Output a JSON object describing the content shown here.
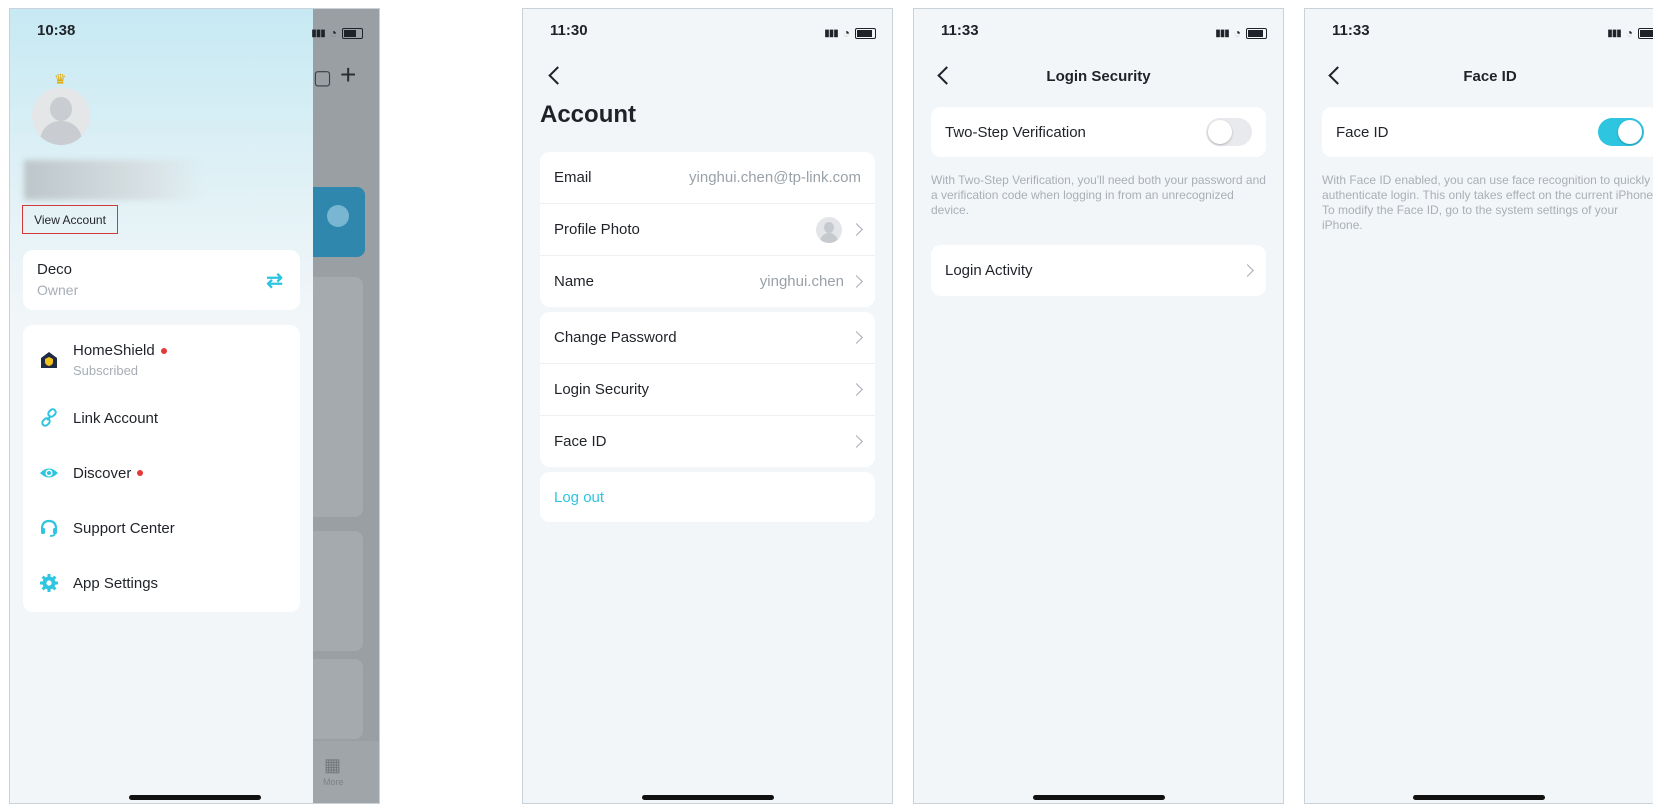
{
  "colors": {
    "accent": "#2ec5e0",
    "red_dot": "#e53935",
    "annotation_box": "#d23a3a"
  },
  "screen1": {
    "time": "10:38",
    "view_account": "View Account",
    "deco_card": {
      "title": "Deco",
      "subtitle": "Owner"
    },
    "menu": [
      {
        "label": "HomeShield",
        "sub": "Subscribed",
        "icon": "homeshield-icon",
        "dot": true
      },
      {
        "label": "Link Account",
        "icon": "link-icon",
        "dot": false
      },
      {
        "label": "Discover",
        "icon": "eye-icon",
        "dot": true
      },
      {
        "label": "Support Center",
        "icon": "headset-icon",
        "dot": false
      },
      {
        "label": "App Settings",
        "icon": "gear-icon",
        "dot": false
      }
    ],
    "bg_tab_label": "More"
  },
  "screen2": {
    "time": "11:30",
    "title": "Account",
    "group1": [
      {
        "label": "Email",
        "value": "yinghui.chen@tp-link.com"
      },
      {
        "label": "Profile Photo"
      },
      {
        "label": "Name",
        "value": "yinghui.chen"
      }
    ],
    "group2": [
      {
        "label": "Change Password"
      },
      {
        "label": "Login Security"
      },
      {
        "label": "Face ID"
      }
    ],
    "logout": "Log out"
  },
  "screen3": {
    "time": "11:33",
    "title": "Login Security",
    "two_step": {
      "label": "Two-Step Verification",
      "enabled": false
    },
    "description": "With Two-Step Verification, you'll need both your password and a verification code when logging in from an unrecognized device.",
    "login_activity": "Login Activity"
  },
  "screen4": {
    "time": "11:33",
    "title": "Face ID",
    "face_id": {
      "label": "Face ID",
      "enabled": true
    },
    "description": "With Face ID enabled, you can use face recognition to quickly authenticate login. This only takes effect on the current iPhone. To modify the Face ID, go to the system settings of your iPhone."
  }
}
